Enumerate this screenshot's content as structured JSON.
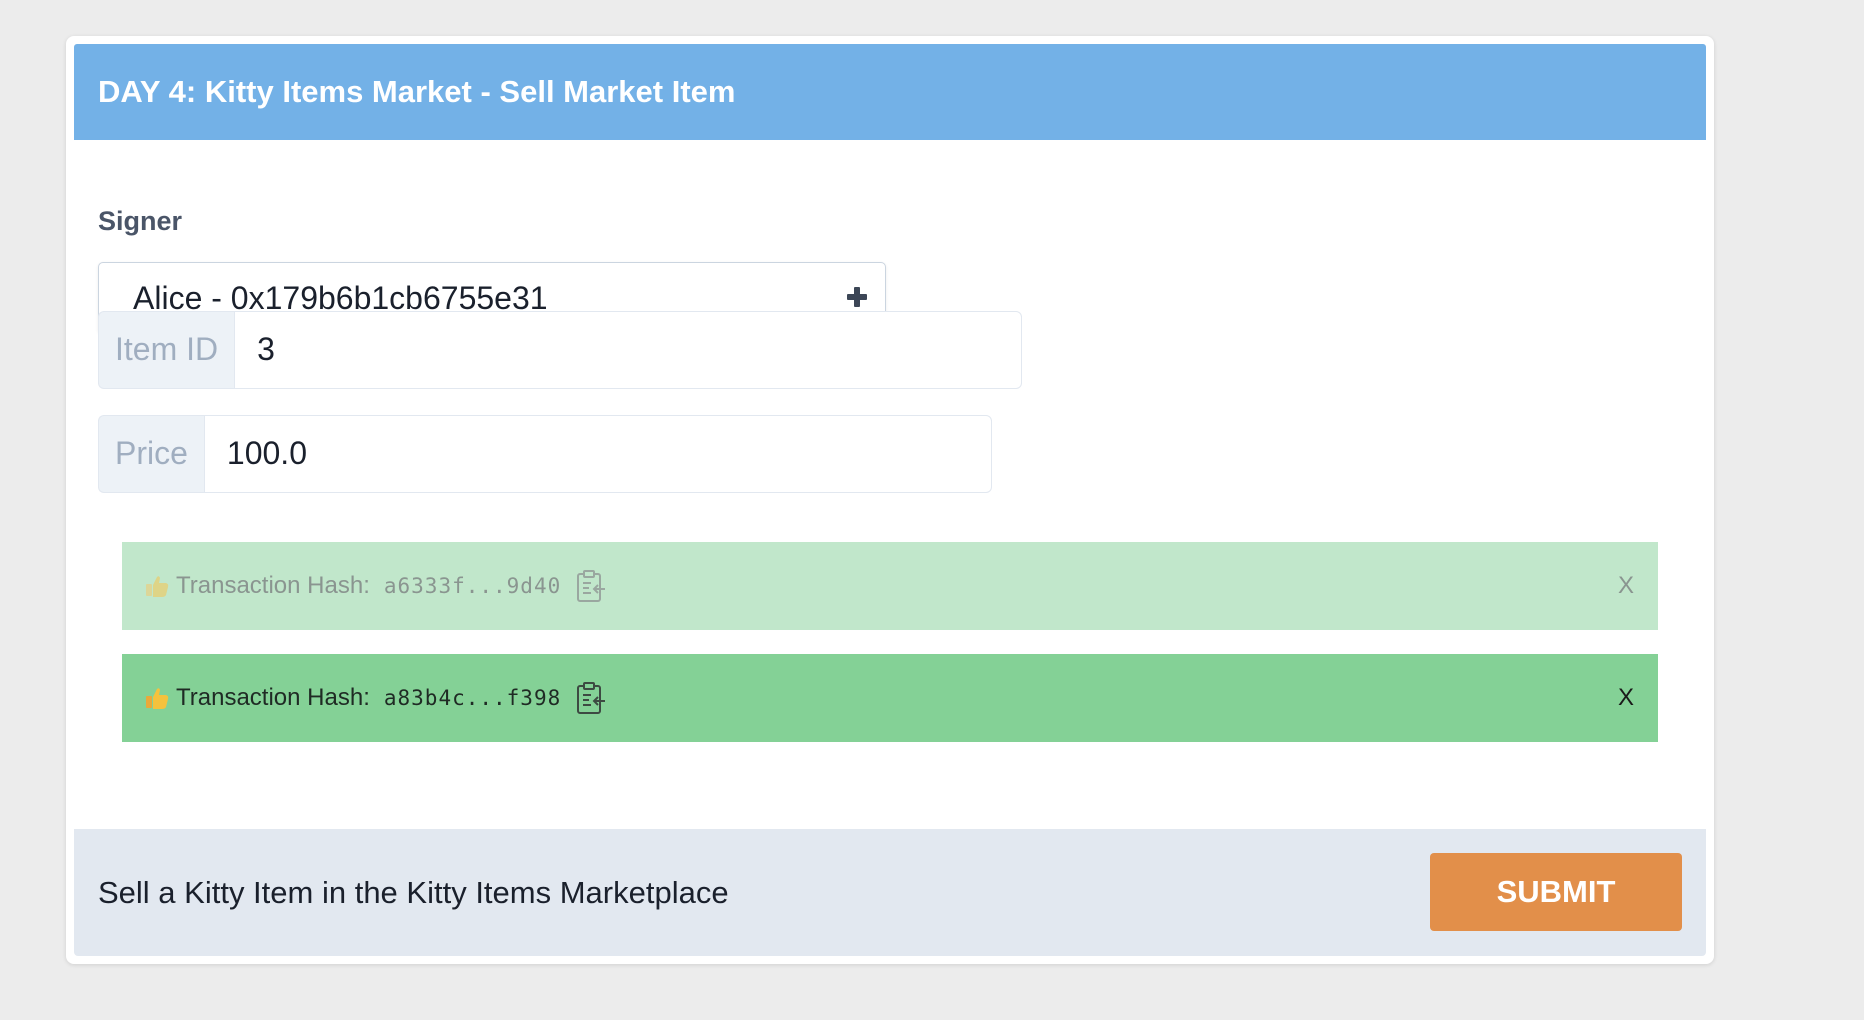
{
  "card": {
    "title": "DAY 4: Kitty Items Market - Sell Market Item"
  },
  "signer": {
    "label": "Signer",
    "selected": "Alice - 0x179b6b1cb6755e31",
    "add_icon": "plus-icon"
  },
  "fields": {
    "item_id": {
      "label": "Item ID",
      "value": "3"
    },
    "price": {
      "label": "Price",
      "value": "100.0"
    }
  },
  "alerts": [
    {
      "icon": "thumbs-up-icon",
      "label": "Transaction Hash:",
      "hash": "a6333f...9d40",
      "copy_icon": "clipboard-icon",
      "close": "X",
      "state": "faded"
    },
    {
      "icon": "thumbs-up-icon",
      "label": "Transaction Hash:",
      "hash": "a83b4c...f398",
      "copy_icon": "clipboard-icon",
      "close": "X",
      "state": "active"
    }
  ],
  "footer": {
    "description": "Sell a Kitty Item in the Kitty Items Marketplace",
    "submit_label": "SUBMIT"
  },
  "colors": {
    "header": "#73b1e7",
    "footer": "#e2e8f0",
    "submit": "#e28f4a",
    "alert_faded": "#c1e7cb",
    "alert_active": "#84d196"
  }
}
